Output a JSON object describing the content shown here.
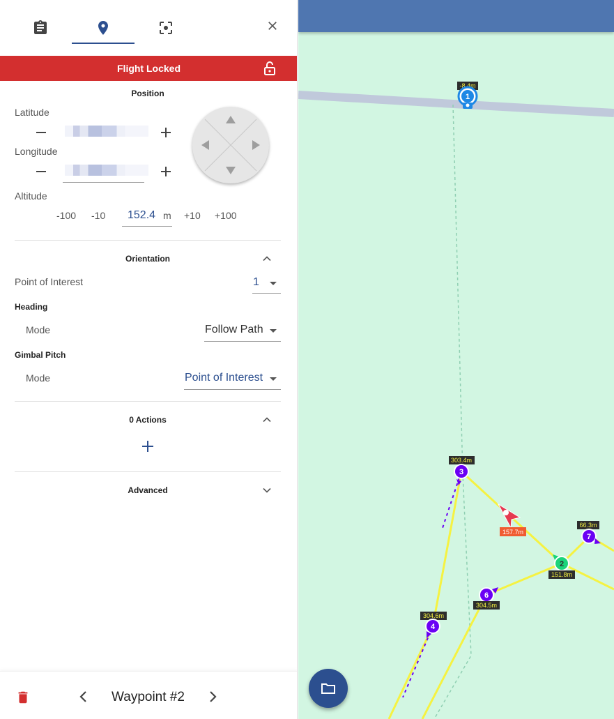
{
  "header": {
    "lock_label": "Flight Locked"
  },
  "position": {
    "title": "Position",
    "latitude_label": "Latitude",
    "longitude_label": "Longitude",
    "altitude_label": "Altitude",
    "altitude_steps": [
      "-100",
      "-10",
      "+10",
      "+100"
    ],
    "altitude_value": "152.4",
    "altitude_unit": "m"
  },
  "orientation": {
    "title": "Orientation",
    "poi_label": "Point of Interest",
    "poi_value": "1",
    "heading_label": "Heading",
    "heading_mode_label": "Mode",
    "heading_mode_value": "Follow Path",
    "gimbal_label": "Gimbal Pitch",
    "gimbal_mode_label": "Mode",
    "gimbal_mode_value": "Point of Interest"
  },
  "actions": {
    "title": "0 Actions"
  },
  "advanced": {
    "title": "Advanced"
  },
  "footer": {
    "waypoint_title": "Waypoint #2"
  },
  "map": {
    "labels": {
      "wp1_alt": "-8.4m",
      "wp3_alt": "303.4m",
      "wp7_alt": "66.3m",
      "drone_alt": "157.7m",
      "wp2_alt": "151.8m",
      "wp6_alt": "304.5m",
      "wp4_alt": "304.6m"
    },
    "waypoints": {
      "wp1": "1",
      "wp2": "2",
      "wp3": "3",
      "wp4": "4",
      "wp6": "6",
      "wp7": "7"
    }
  },
  "colors": {
    "accent": "#2c4f8f",
    "lock_bar": "#d32f2f",
    "map_bg": "#d2f6e2",
    "map_topbar": "#4f76b0",
    "path": "#f5f242",
    "waypoint": "#6a00f4",
    "selected_waypoint": "#19d47a",
    "drone": "#e53950"
  }
}
